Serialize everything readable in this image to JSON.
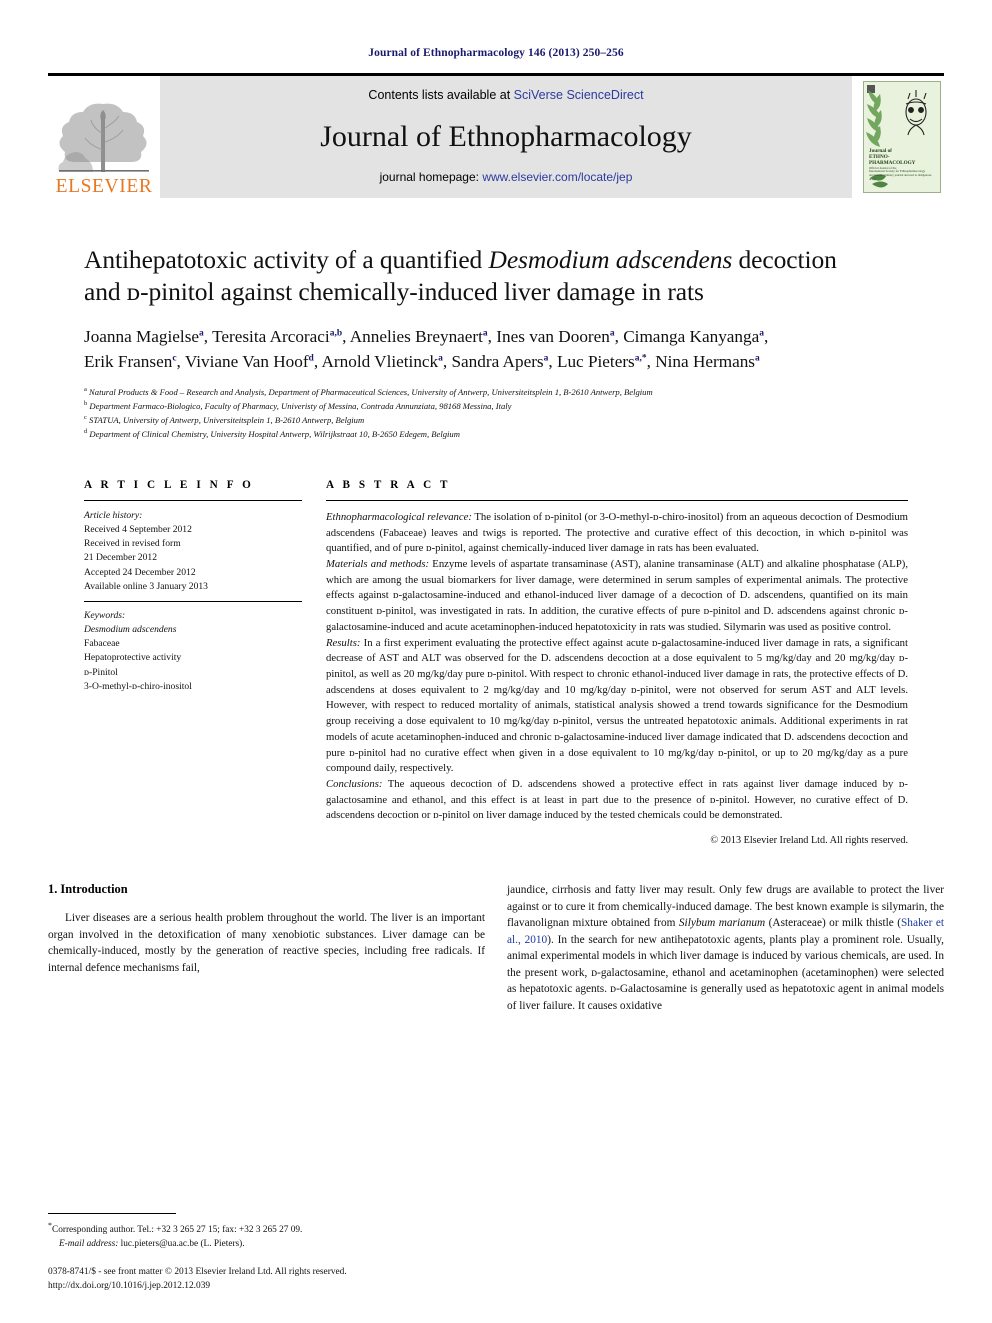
{
  "running_head": "Journal of Ethnopharmacology 146 (2013) 250–256",
  "masthead": {
    "publisher_name": "ELSEVIER",
    "publisher_logo_icon": "elsevier-tree-icon",
    "contents_prefix": "Contents lists available at",
    "sciencedirect_link": "SciVerse ScienceDirect",
    "journal_title": "Journal of Ethnopharmacology",
    "homepage_prefix": "journal homepage:",
    "homepage_url": "www.elsevier.com/locate/jep",
    "cover_title_lines": [
      "Journal of",
      "ETHNO-",
      "PHARMACOLOGY"
    ],
    "cover_sub_lines": [
      "Official Journal of the",
      "International Society for Ethnopharmacology",
      "An interdisciplinary journal devoted to indigenous drugs"
    ],
    "link_color": "#2b3b9e",
    "banner_bg": "#e3e3e3",
    "brand_orange": "#e87722"
  },
  "article": {
    "title_line1_pre": "Antihepatotoxic activity of a quantified ",
    "title_line1_italic": "Desmodium adscendens",
    "title_line1_post": " decoction",
    "title_line2": "and ᴅ-pinitol against chemically-induced liver damage in rats",
    "authors": [
      {
        "name": "Joanna Magielse",
        "marks": "a"
      },
      {
        "name": "Teresita Arcoraci",
        "marks": "a,b"
      },
      {
        "name": "Annelies Breynaert",
        "marks": "a"
      },
      {
        "name": "Ines van Dooren",
        "marks": "a"
      },
      {
        "name": "Cimanga Kanyanga",
        "marks": "a"
      },
      {
        "name": "Erik Fransen",
        "marks": "c"
      },
      {
        "name": "Viviane Van Hoof",
        "marks": "d"
      },
      {
        "name": "Arnold Vlietinck",
        "marks": "a"
      },
      {
        "name": "Sandra Apers",
        "marks": "a"
      },
      {
        "name": "Luc Pieters",
        "marks": "a,*"
      },
      {
        "name": "Nina Hermans",
        "marks": "a"
      }
    ],
    "affiliations": [
      {
        "mark": "a",
        "text": "Natural Products & Food – Research and Analysis, Department of Pharmaceutical Sciences, University of Antwerp, Universiteitsplein 1, B-2610 Antwerp, Belgium"
      },
      {
        "mark": "b",
        "text": "Department Farmaco-Biologico, Faculty of Pharmacy, Univeristy of Messina, Contrada Annunziata, 98168 Messina, Italy"
      },
      {
        "mark": "c",
        "text": "STATUA, University of Antwerp, Universiteitsplein 1, B-2610 Antwerp, Belgium"
      },
      {
        "mark": "d",
        "text": "Department of Clinical Chemistry, University Hospital Antwerp, Wilrijkstraat 10, B-2650 Edegem, Belgium"
      }
    ]
  },
  "article_info": {
    "heading": "A R T I C L E  I N F O",
    "history_label": "Article history:",
    "history": [
      "Received 4 September 2012",
      "Received in revised form",
      "21 December 2012",
      "Accepted 24 December 2012",
      "Available online 3 January 2013"
    ],
    "keywords_label": "Keywords:",
    "keywords": [
      "Desmodium adscendens",
      "Fabaceae",
      "Hepatoprotective activity",
      "ᴅ-Pinitol",
      "3-O-methyl-ᴅ-chiro-inositol"
    ]
  },
  "abstract": {
    "heading": "A B S T R A C T",
    "paragraphs": [
      {
        "label": "Ethnopharmacological relevance:",
        "text": " The isolation of ᴅ-pinitol (or 3-O-methyl-ᴅ-chiro-inositol) from an aqueous decoction of Desmodium adscendens (Fabaceae) leaves and twigs is reported. The protective and curative effect of this decoction, in which ᴅ-pinitol was quantified, and of pure ᴅ-pinitol, against chemically-induced liver damage in rats has been evaluated."
      },
      {
        "label": "Materials and methods:",
        "text": " Enzyme levels of aspartate transaminase (AST), alanine transaminase (ALT) and alkaline phosphatase (ALP), which are among the usual biomarkers for liver damage, were determined in serum samples of experimental animals. The protective effects against ᴅ-galactosamine-induced and ethanol-induced liver damage of a decoction of D. adscendens, quantified on its main constituent ᴅ-pinitol, was investigated in rats. In addition, the curative effects of pure ᴅ-pinitol and D. adscendens against chronic ᴅ-galactosamine-induced and acute acetaminophen-induced hepatotoxicity in rats was studied. Silymarin was used as positive control."
      },
      {
        "label": "Results:",
        "text": " In a first experiment evaluating the protective effect against acute ᴅ-galactosamine-induced liver damage in rats, a significant decrease of AST and ALT was observed for the D. adscendens decoction at a dose equivalent to 5 mg/kg/day and 20 mg/kg/day ᴅ-pinitol, as well as 20 mg/kg/day pure ᴅ-pinitol. With respect to chronic ethanol-induced liver damage in rats, the protective effects of D. adscendens at doses equivalent to 2 mg/kg/day and 10 mg/kg/day ᴅ-pinitol, were not observed for serum AST and ALT levels. However, with respect to reduced mortality of animals, statistical analysis showed a trend towards significance for the Desmodium group receiving a dose equivalent to 10 mg/kg/day ᴅ-pinitol, versus the untreated hepatotoxic animals. Additional experiments in rat models of acute acetaminophen-induced and chronic ᴅ-galactosamine-induced liver damage indicated that D. adscendens decoction and pure ᴅ-pinitol had no curative effect when given in a dose equivalent to 10 mg/kg/day ᴅ-pinitol, or up to 20 mg/kg/day as a pure compound daily, respectively."
      },
      {
        "label": "Conclusions:",
        "text": " The aqueous decoction of D. adscendens showed a protective effect in rats against liver damage induced by ᴅ-galactosamine and ethanol, and this effect is at least in part due to the presence of ᴅ-pinitol. However, no curative effect of D. adscendens decoction or ᴅ-pinitol on liver damage induced by the tested chemicals could be demonstrated."
      }
    ],
    "copyright": "© 2013 Elsevier Ireland Ltd. All rights reserved."
  },
  "body": {
    "section_heading": "1.  Introduction",
    "left_paragraph": "Liver diseases are a serious health problem throughout the world. The liver is an important organ involved in the detoxification of many xenobiotic substances. Liver damage can be chemically-induced, mostly by the generation of reactive species, including free radicals. If internal defence mechanisms fail,",
    "right_paragraph_pre": "jaundice, cirrhosis and fatty liver may result. Only few drugs are available to protect the liver against or to cure it from chemically-induced damage. The best known example is silymarin, the flavanolignan mixture obtained from ",
    "right_italic_1": "Silybum marianum",
    "right_paragraph_mid": " (Asteraceae) or milk thistle (",
    "right_citation": "Shaker et al., 2010",
    "right_paragraph_post": "). In the search for new antihepatotoxic agents, plants play a prominent role. Usually, animal experimental models in which liver damage is induced by various chemicals, are used. In the present work, ᴅ-galactosamine, ethanol and acetaminophen (acetaminophen) were selected as hepatotoxic agents. ᴅ-Galactosamine is generally used as hepatotoxic agent in animal models of liver failure. It causes oxidative",
    "citation_color": "#1a3a9e"
  },
  "footnotes": {
    "corresponding": "Corresponding author. Tel.: +32 3 265 27 15; fax: +32 3 265 27 09.",
    "email_label": "E-mail address:",
    "email": "luc.pieters@ua.ac.be (L. Pieters).",
    "issn_line": "0378-8741/$ - see front matter © 2013 Elsevier Ireland Ltd. All rights reserved.",
    "doi_line": "http://dx.doi.org/10.1016/j.jep.2012.12.039"
  }
}
